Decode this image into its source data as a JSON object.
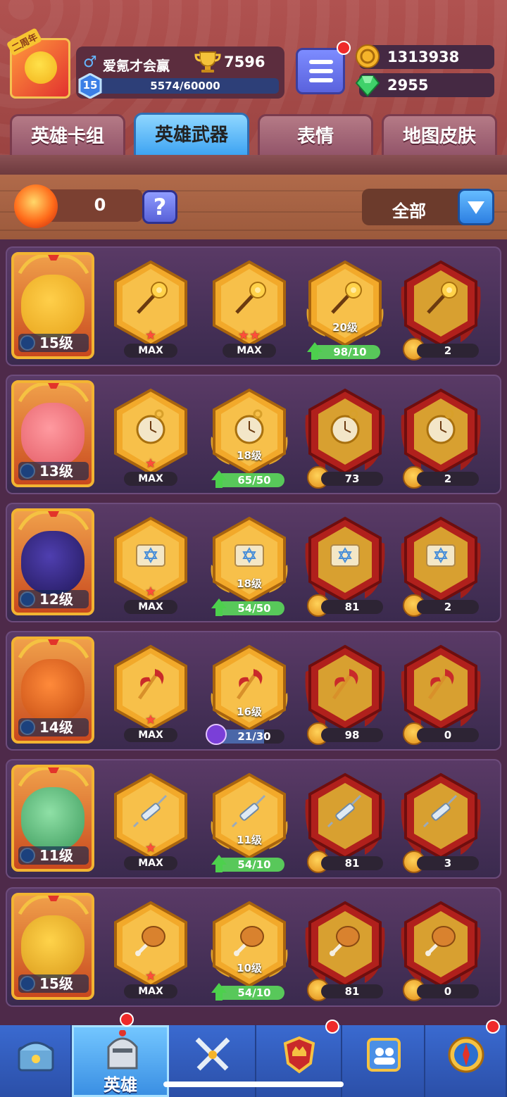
{
  "profile": {
    "anniversary_tag": "二周年",
    "anniversary_num": "2",
    "gender": "♂",
    "name": "爱氪才会赢",
    "trophies": "7596",
    "level": "15",
    "xp": "5574/60000"
  },
  "resources": {
    "gold": "1313938",
    "gems": "2955"
  },
  "tabs": [
    {
      "label": "英雄卡组"
    },
    {
      "label": "英雄武器",
      "active": true
    },
    {
      "label": "表情"
    },
    {
      "label": "地图皮肤"
    }
  ],
  "toolbar": {
    "fire_count": "0",
    "help_label": "?",
    "filter_label": "全部"
  },
  "heroes": [
    {
      "level": "15级",
      "weapon": "staff",
      "slots": [
        {
          "type": "max",
          "stars": "★",
          "label": "MAX"
        },
        {
          "type": "max",
          "stars": "★★",
          "label": "MAX"
        },
        {
          "type": "upgrade",
          "level": "20级",
          "progress": "98/10",
          "fill": 1.0,
          "style": "green"
        },
        {
          "type": "locked",
          "count": "2"
        }
      ]
    },
    {
      "level": "13级",
      "weapon": "watch",
      "slots": [
        {
          "type": "max",
          "stars": "★",
          "label": "MAX"
        },
        {
          "type": "upgrade",
          "level": "18级",
          "progress": "65/50",
          "fill": 1.0,
          "style": "green"
        },
        {
          "type": "locked",
          "count": "73"
        },
        {
          "type": "locked",
          "count": "2"
        }
      ]
    },
    {
      "level": "12级",
      "weapon": "scroll",
      "slots": [
        {
          "type": "max",
          "stars": "★",
          "label": "MAX"
        },
        {
          "type": "upgrade",
          "level": "18级",
          "progress": "54/50",
          "fill": 1.0,
          "style": "green"
        },
        {
          "type": "locked",
          "count": "81"
        },
        {
          "type": "locked",
          "count": "2"
        }
      ]
    },
    {
      "level": "14级",
      "weapon": "halberd",
      "slots": [
        {
          "type": "max",
          "stars": "★",
          "label": "MAX"
        },
        {
          "type": "upgrade",
          "level": "16级",
          "progress": "21/30",
          "fill": 0.7,
          "style": "purple"
        },
        {
          "type": "locked",
          "count": "98"
        },
        {
          "type": "locked",
          "count": "0"
        }
      ]
    },
    {
      "level": "11级",
      "weapon": "syringe",
      "slots": [
        {
          "type": "max",
          "stars": "★",
          "label": "MAX"
        },
        {
          "type": "upgrade",
          "level": "11级",
          "progress": "54/10",
          "fill": 1.0,
          "style": "green"
        },
        {
          "type": "locked",
          "count": "81"
        },
        {
          "type": "locked",
          "count": "3"
        }
      ]
    },
    {
      "level": "15级",
      "weapon": "drumstick",
      "slots": [
        {
          "type": "max",
          "stars": "★",
          "label": "MAX"
        },
        {
          "type": "upgrade",
          "level": "10级",
          "progress": "54/10",
          "fill": 1.0,
          "style": "green"
        },
        {
          "type": "locked",
          "count": "81"
        },
        {
          "type": "locked",
          "count": "0"
        }
      ]
    }
  ],
  "bottom_nav": [
    {
      "icon": "chest-icon",
      "label": ""
    },
    {
      "icon": "knight-helmet-icon",
      "label": "英雄",
      "active": true
    },
    {
      "icon": "crossed-swords-icon",
      "label": ""
    },
    {
      "icon": "shield-crown-icon",
      "label": ""
    },
    {
      "icon": "friends-icon",
      "label": ""
    },
    {
      "icon": "compass-icon",
      "label": ""
    }
  ],
  "colors": {
    "background": "#8a3b3a",
    "active_tab": "#3ba2f2",
    "row_bg": "#4a3358",
    "gold_hex": "#f2a92a",
    "red_hex": "#b0201c",
    "progress_green": "#58c85a"
  }
}
